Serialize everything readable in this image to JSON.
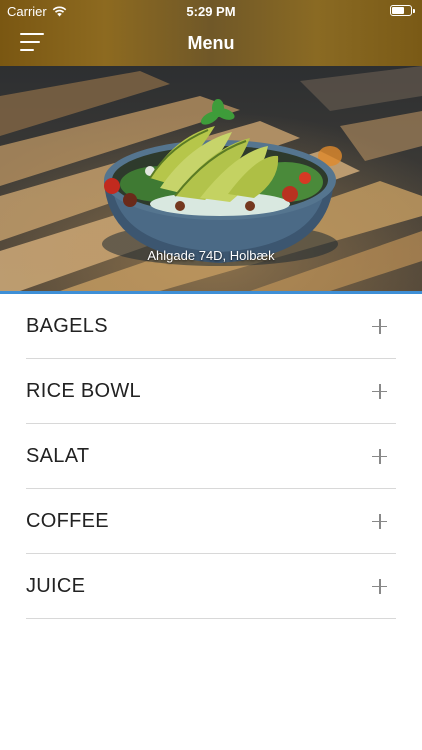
{
  "status_bar": {
    "carrier": "Carrier",
    "time": "5:29 PM"
  },
  "nav": {
    "title": "Menu",
    "menu_icon": "hamburger-menu-icon"
  },
  "hero": {
    "address": "Ahlgade 74D, Holbæk"
  },
  "menu": {
    "items": [
      {
        "label": "BAGELS"
      },
      {
        "label": "RICE BOWL"
      },
      {
        "label": "SALAT"
      },
      {
        "label": "COFFEE"
      },
      {
        "label": "JUICE"
      }
    ]
  },
  "colors": {
    "nav_gold": "#7a5712",
    "accent_line": "#3e8fd6",
    "divider": "#d8d8d8"
  }
}
